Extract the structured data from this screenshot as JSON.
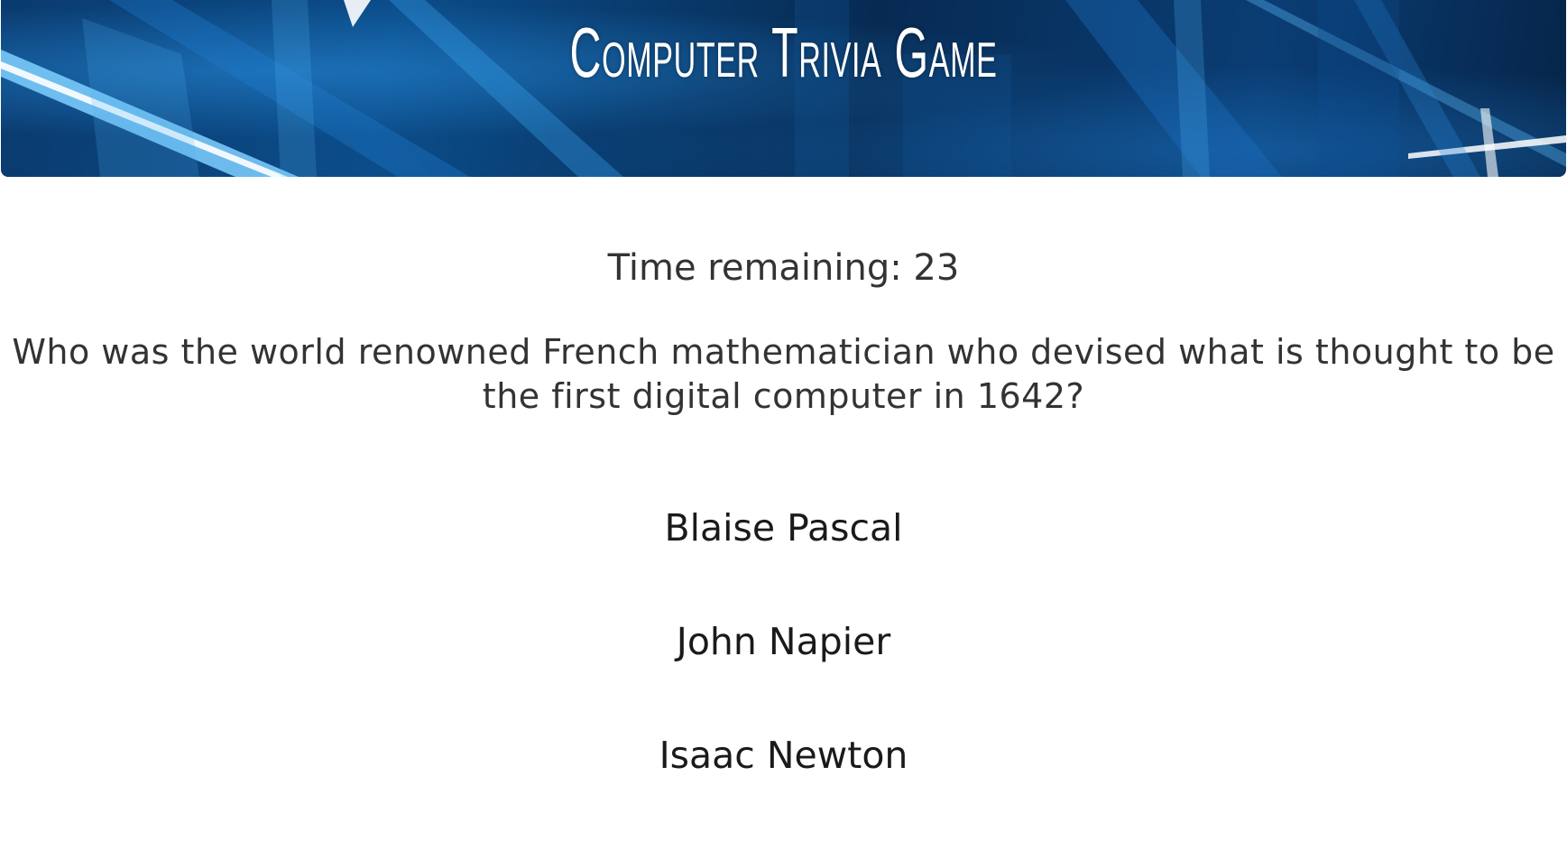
{
  "header": {
    "title": "Computer Trivia Game"
  },
  "game": {
    "timer_label": "Time remaining: 23",
    "question": "Who was the world renowned French mathematician who devised what is thought to be the first digital computer in 1642?",
    "answers": [
      {
        "label": "Blaise Pascal"
      },
      {
        "label": "John Napier"
      },
      {
        "label": "Isaac Newton"
      }
    ]
  },
  "colors": {
    "banner_dark": "#072a52",
    "banner_light": "#2e8fd8",
    "text": "#333333"
  }
}
